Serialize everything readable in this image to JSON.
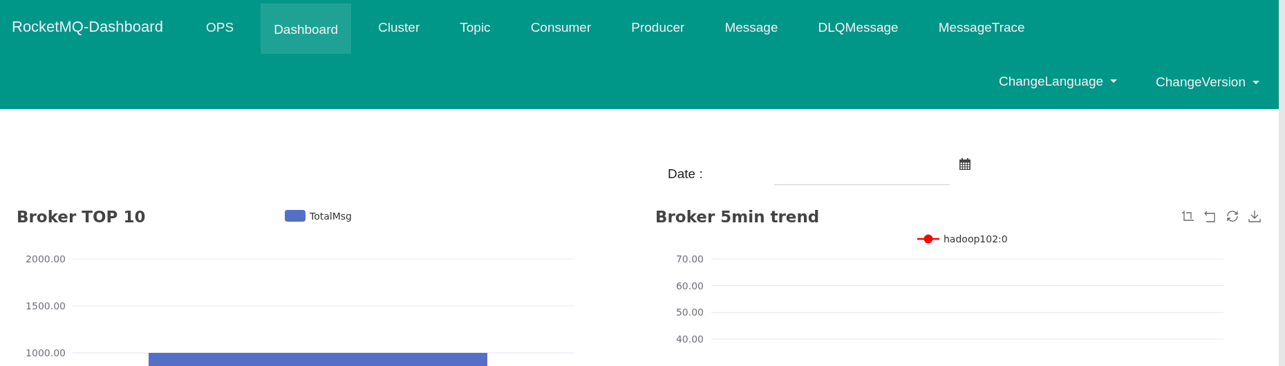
{
  "brand": "RocketMQ-Dashboard",
  "nav": [
    {
      "label": "OPS",
      "selected": false
    },
    {
      "label": "Dashboard",
      "selected": true
    },
    {
      "label": "Cluster",
      "selected": false
    },
    {
      "label": "Topic",
      "selected": false
    },
    {
      "label": "Consumer",
      "selected": false
    },
    {
      "label": "Producer",
      "selected": false
    },
    {
      "label": "Message",
      "selected": false
    },
    {
      "label": "DLQMessage",
      "selected": false
    },
    {
      "label": "MessageTrace",
      "selected": false
    }
  ],
  "menus": [
    "ChangeLanguage",
    "ChangeVersion"
  ],
  "date": {
    "label": "Date :"
  },
  "charts": [
    {
      "title": "Broker TOP 10",
      "chart_data": {
        "type": "bar",
        "series": [
          {
            "name": "TotalMsg",
            "color": "#5470c6",
            "values": [
              1000
            ]
          }
        ],
        "ylim": [
          0,
          2000
        ],
        "grid": true,
        "yticks": [
          {
            "value": 1000,
            "label": "1000.00"
          },
          {
            "value": 1500,
            "label": "1500.00"
          },
          {
            "value": 2000,
            "label": "2000.00"
          }
        ]
      }
    },
    {
      "title": "Broker 5min trend",
      "chart_data": {
        "type": "line",
        "series": [
          {
            "name": "hadoop102:0",
            "color": "#ff0000"
          }
        ],
        "ylim": [
          40,
          70
        ],
        "grid": true,
        "yticks": [
          {
            "value": 40,
            "label": "40.00"
          },
          {
            "value": 50,
            "label": "50.00"
          },
          {
            "value": 60,
            "label": "60.00"
          },
          {
            "value": 70,
            "label": "70.00"
          }
        ]
      }
    }
  ]
}
